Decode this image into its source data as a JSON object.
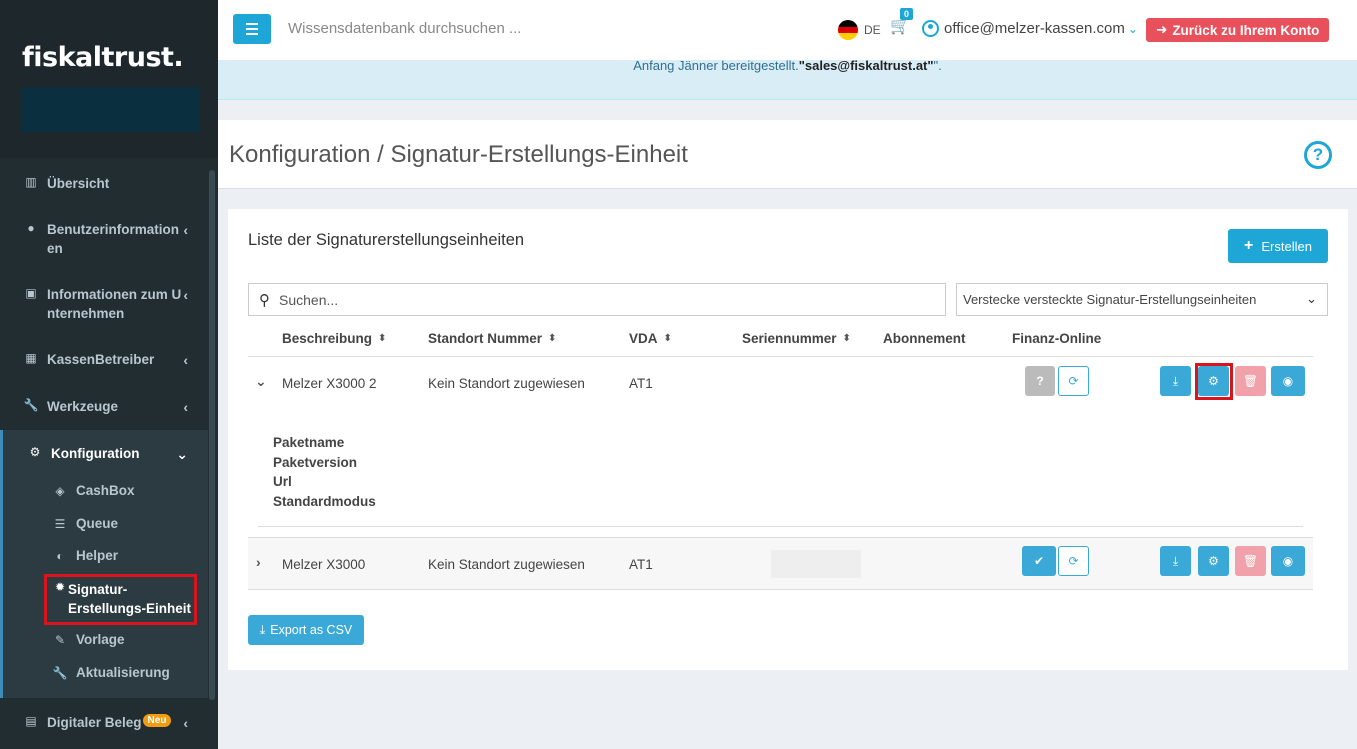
{
  "sidebar": {
    "logo": "fiskaltrust.",
    "items": [
      {
        "label": "Übersicht",
        "icon": "bar-chart-icon"
      },
      {
        "label": "Benutzerinformation",
        "label2": "en",
        "icon": "user-circle-icon"
      },
      {
        "label": "Informationen zum U",
        "label2": "nternehmen",
        "icon": "briefcase-icon"
      },
      {
        "label": "KassenBetreiber",
        "icon": "building-icon"
      },
      {
        "label": "Werkzeuge",
        "icon": "wrench-icon"
      },
      {
        "label": "Konfiguration",
        "icon": "cogs-icon"
      }
    ],
    "sub_items": [
      {
        "label": "CashBox",
        "icon": "cube-icon"
      },
      {
        "label": "Queue",
        "icon": "database-icon"
      },
      {
        "label": "Helper",
        "icon": "half-circle-icon"
      },
      {
        "label": "Signatur-",
        "label2": "Erstellungs-Einheit",
        "icon": "gear-icon"
      },
      {
        "label": "Vorlage",
        "icon": "edit-icon"
      },
      {
        "label": "Aktualisierung",
        "icon": "wrench-icon"
      }
    ],
    "bottom_item": {
      "label": "Digitaler Beleg",
      "badge": "Neu",
      "icon": "receipt-icon"
    }
  },
  "header": {
    "search_placeholder": "Wissensdatenbank durchsuchen ...",
    "language": "DE",
    "cart_count": "0",
    "user_email": "office@melzer-kassen.com",
    "back_button": "Zurück zu Ihrem Konto"
  },
  "announcement": {
    "text_before": "Anfang Jänner bereitgestellt.",
    "email": "\"sales@fiskaltrust.at\"",
    "text_after": "\"."
  },
  "page": {
    "title": "Konfiguration / Signatur-Erstellungs-Einheit"
  },
  "box": {
    "title": "Liste der Signaturerstellungseinheiten",
    "create_button": "Erstellen",
    "search_placeholder": "Suchen...",
    "filter_value": "Verstecke versteckte Signatur-Erstellungseinheiten",
    "columns": [
      "Beschreibung",
      "Standort Nummer",
      "VDA",
      "Seriennummer",
      "Abonnement",
      "Finanz-Online"
    ],
    "rows": [
      {
        "beschreibung": "Melzer X3000 2",
        "standort": "Kein Standort zugewiesen",
        "vda": "AT1",
        "finanz_status": "?"
      },
      {
        "beschreibung": "Melzer X3000",
        "standort": "Kein Standort zugewiesen",
        "vda": "AT1",
        "finanz_status": "✔"
      }
    ],
    "detail_labels": [
      "Paketname",
      "Paketversion",
      "Url",
      "Standardmodus"
    ],
    "export_button": "Export as CSV"
  },
  "colors": {
    "sidebar_bg": "#222d32",
    "accent": "#1ea7d6",
    "danger": "#e8515b",
    "highlight": "#d9141d"
  }
}
